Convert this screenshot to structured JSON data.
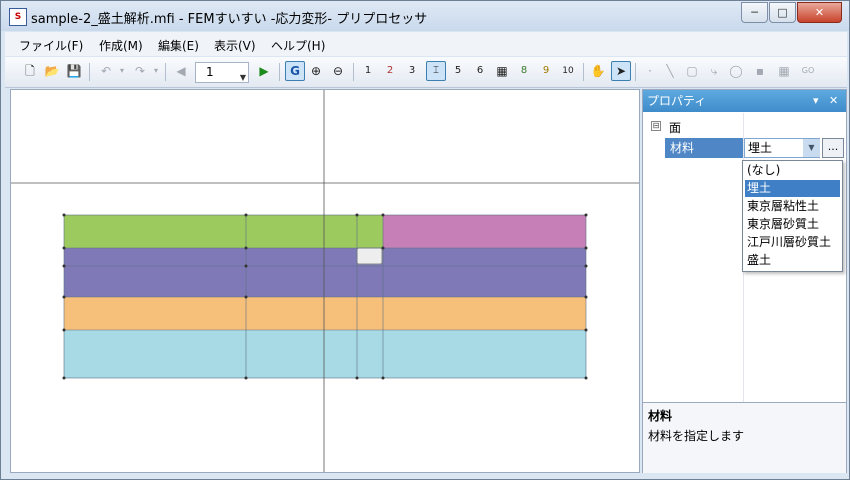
{
  "window": {
    "title": "sample-2_盛土解析.mfi - FEMすいすい -応力変形- プリプロセッサ",
    "minimize": "─",
    "maximize": "□",
    "close": "✕"
  },
  "menu": [
    {
      "label": "ファイル(F)"
    },
    {
      "label": "作成(M)"
    },
    {
      "label": "編集(E)"
    },
    {
      "label": "表示(V)"
    },
    {
      "label": "ヘルプ(H)"
    }
  ],
  "toolbar": {
    "page_value": "1",
    "icons": [
      "new-file-icon",
      "open-folder-icon",
      "save-icon",
      "undo-icon",
      "redo-icon",
      "prev-page-icon",
      "next-page-icon",
      "grid-snap-icon",
      "zoom-in-icon",
      "zoom-out-icon",
      "hand-pan-icon",
      "pointer-icon"
    ],
    "grid_snap": "G",
    "label_tool_1": "1",
    "label_tool_2": "2",
    "label_tool_3": "3",
    "label_tool_5": "5",
    "label_tool_6": "6",
    "label_tool_8": "8",
    "label_tool_9": "9",
    "label_tool_10": "10"
  },
  "mesh": {
    "regions": [
      {
        "material": "埋土",
        "color": "#9dca5f"
      },
      {
        "material": "盛土",
        "color": "#c780b7"
      },
      {
        "material": "東京層粘性土",
        "color": "#7f79b8"
      },
      {
        "material": "東京層砂質土",
        "color": "#f6c07b"
      },
      {
        "material": "江戸川層砂質土",
        "color": "#a8dae6"
      },
      {
        "material": "selected-cell",
        "color": "#eeeeee"
      }
    ]
  },
  "properties": {
    "panel_title": "プロパティ",
    "pin": "▾",
    "close": "✕",
    "category_toggle": "⊟",
    "category": "面",
    "field_label": "材料",
    "field_value": "埋土",
    "more_button": "...",
    "options": [
      "(なし)",
      "埋土",
      "東京層粘性土",
      "東京層砂質土",
      "江戸川層砂質土",
      "盛土"
    ],
    "selected_option": 1,
    "description_title": "材料",
    "description_text": "材料を指定します"
  }
}
